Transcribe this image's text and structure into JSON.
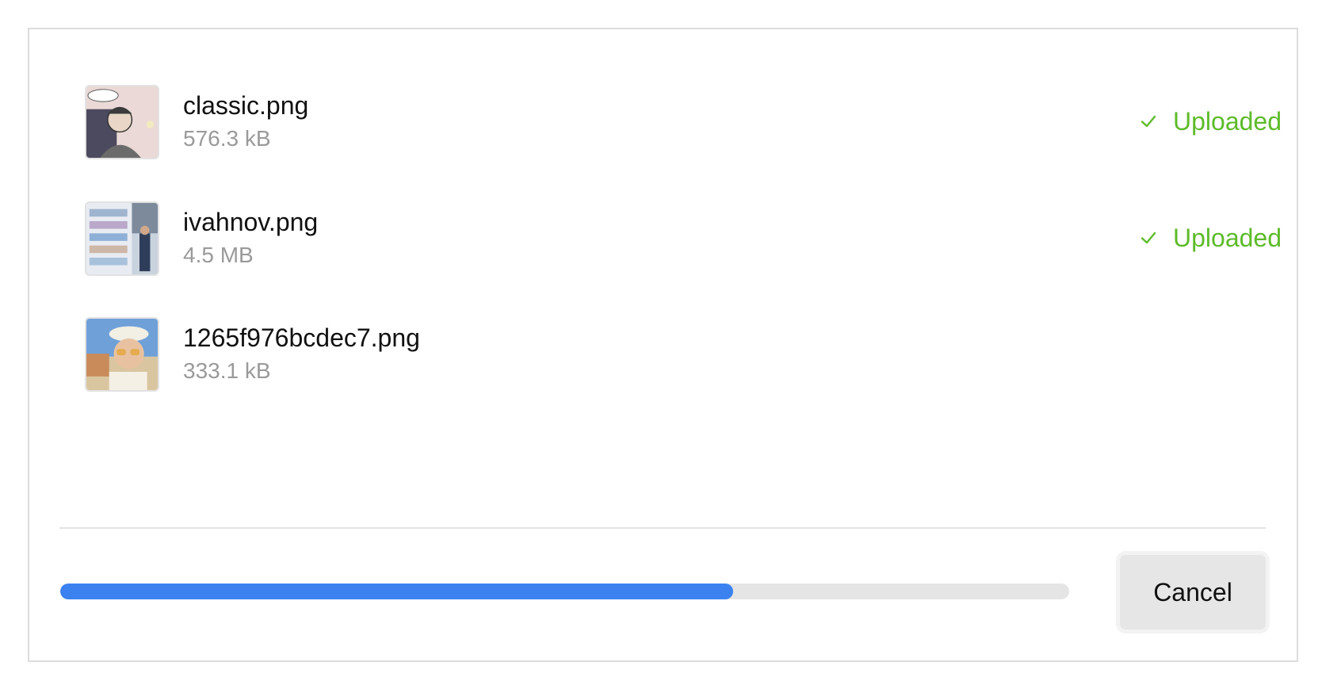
{
  "files": [
    {
      "name": "classic.png",
      "size": "576.3 kB",
      "status": "Uploaded",
      "status_icon": "check-icon",
      "thumbnail": "comic-portrait-thumbnail"
    },
    {
      "name": "ivahnov.png",
      "size": "4.5 MB",
      "status": "Uploaded",
      "status_icon": "check-icon",
      "thumbnail": "store-aisle-thumbnail"
    },
    {
      "name": "1265f976bcdec7.png",
      "size": "333.1 kB",
      "status": "",
      "status_icon": "",
      "thumbnail": "person-in-hat-thumbnail"
    }
  ],
  "progress": {
    "fraction": 0.667
  },
  "footer": {
    "cancel_label": "Cancel"
  },
  "colors": {
    "accent": "#3b82f0",
    "success": "#5dbb29",
    "track": "#e5e5e5",
    "muted_text": "#9a9a9a"
  }
}
